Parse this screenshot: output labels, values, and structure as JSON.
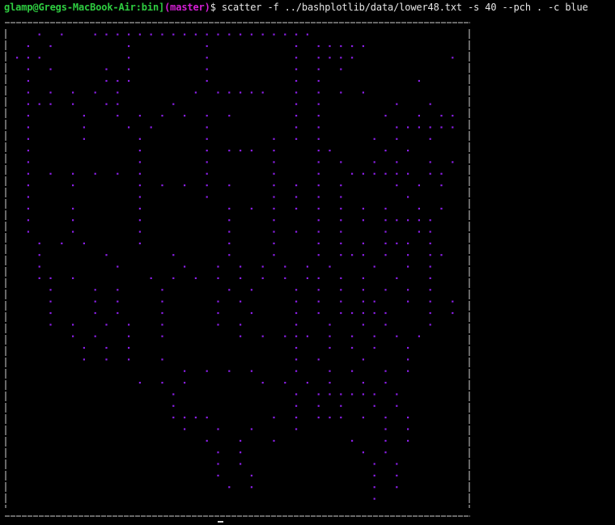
{
  "prompt": {
    "user_host": "glamp@Gregs-MacBook-Air:bin]",
    "branch": "(master)",
    "dollar": "$ ",
    "command": "scatter -f ../bashplotlib/data/lower48.txt -s 40 --pch . -c blue"
  },
  "colors": {
    "background": "#000000",
    "prompt_user": "#2ecc40",
    "prompt_branch": "#d41fd4",
    "text": "#e6e6e6",
    "points": "#8a1fe6",
    "border": "#cfcfcf"
  },
  "chart_data": {
    "type": "scatter",
    "title": "",
    "xlabel": "",
    "ylabel": "",
    "grid": false,
    "marker": ".",
    "xlim": [
      0,
      39
    ],
    "ylim": [
      0,
      40
    ],
    "rows": [
      "  . .  ....................             ",
      " . .      .      .       . .....        ",
      "...       .      .       . ....        .",
      " . .    . .      .       . . .          ",
      " .      ...      .       . .        .   ",
      " . . . . .      . .....  . . . .        ",
      " ... .  ..    .          . .      .  .  ",
      " .    .  . . . . . .     . .     .  . ..",
      " .    .   . .    .       . .      ......",
      " .    .    .     .     . . .    . .  .  ",
      " .         .     . ... .   ..    . .    ",
      " .         .     .     .   . .  . .  . .",
      " . . . . . .     .     .   .  ...... .. ",
      " .   .     . . . . .   . . . .    . . . ",
      " .         .     .     . . . .     .    ",
      " .   .     .       . . . . . . . .  . . ",
      " .   .     .       .   .   . . . .....  ",
      " .   .     .       .   . . . .   .  ..  ",
      "  . . .    .       .   .   . . . ... .  ",
      "  .     .     .    .   .   . ... . . .. ",
      "  .      .     .  . . . . . .   .  . .  ",
      "  .. .      . . . . . . . .. . .  .  .  ",
      "   .   . .   .     . .   . . . . . . .  ",
      "   .   . .   .    . .    . . . ..  . . .",
      "   .   . .   .    .  .   . . .....   . .",
      "   . .  . .  .    . .    .  .  . .   .  ",
      "     . .  .  .      . . ... . . . . .   ",
      "      . . .              .  . . .  .    ",
      "      . . .  .           . .   .   .    ",
      "               . . . .   .  . .  . .    ",
      "           . . .      . . . .  . .      ",
      "              .          . ...... .     ",
      "              .          . . .  . .     ",
      "              ....     . . ... . . .    ",
      "               .  .  .   .       . .    ",
      "                 .  .  .      .  . .    ",
      "                  . .          . .      ",
      "                  . .           . .     ",
      "                  .  .          . .     ",
      "                   . .          . .     ",
      "                                .       "
    ]
  }
}
